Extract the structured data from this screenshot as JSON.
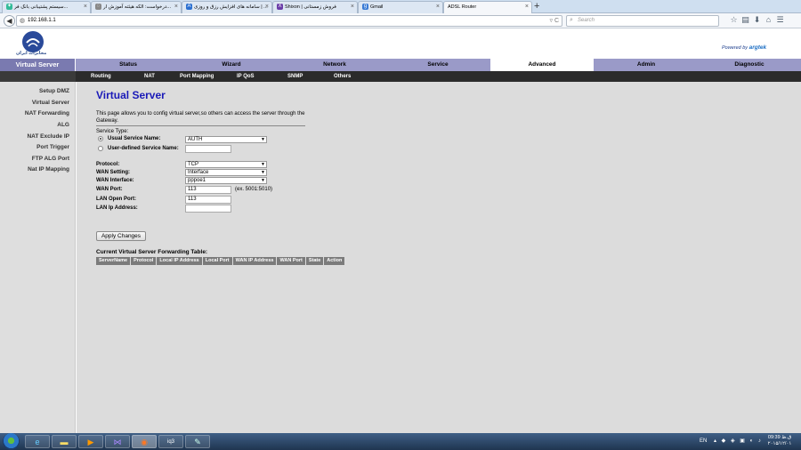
{
  "browser": {
    "tabs": [
      {
        "label": "سیستم پشتیبانی بانک فر...",
        "active": false
      },
      {
        "label": "درخواست: الکه هیئته آموزش ار...",
        "active": false
      },
      {
        "label": "سامانه های افزایش رزق و روزی | ...",
        "active": false
      },
      {
        "label": "Shixon | فروش زمستانی",
        "active": false
      },
      {
        "label": "Gmail",
        "active": false
      },
      {
        "label": "ADSL Router",
        "active": true
      }
    ],
    "url": "192.168.1.1",
    "search_placeholder": "Search"
  },
  "router": {
    "powered_prefix": "Powered by",
    "powered_brand": "argtek",
    "section_title": "Virtual Server",
    "menu": [
      "Status",
      "Wizard",
      "Network",
      "Service",
      "Advanced",
      "Admin",
      "Diagnostic"
    ],
    "menu_active": "Advanced",
    "submenu": [
      "Routing",
      "NAT",
      "Port Mapping",
      "IP QoS",
      "SNMP",
      "Others"
    ],
    "sidebar": [
      "Setup DMZ",
      "Virtual Server",
      "NAT Forwarding",
      "ALG",
      "NAT Exclude IP",
      "Port Trigger",
      "FTP ALG Port",
      "Nat IP Mapping"
    ]
  },
  "page": {
    "title": "Virtual Server",
    "description": "This page allows you to config virtual server,so others can access the server through the Gateway.",
    "service_type_label": "Service Type:",
    "usual_service_label": "Usual Service Name:",
    "usual_service_value": "AUTH",
    "user_defined_label": "User-defined Service Name:",
    "user_defined_value": "",
    "protocol_label": "Protocol:",
    "protocol_value": "TCP",
    "wan_setting_label": "WAN Setting:",
    "wan_setting_value": "Interface",
    "wan_interface_label": "WAN Interface:",
    "wan_interface_value": "pppoe1",
    "wan_port_label": "WAN Port:",
    "wan_port_value": "113",
    "wan_port_hint": "(ex. 5001:5010)",
    "lan_open_port_label": "LAN Open Port:",
    "lan_open_port_value": "113",
    "lan_ip_label": "LAN Ip Address:",
    "lan_ip_value": "",
    "apply_button": "Apply Changes",
    "table_title": "Current Virtual Server Forwarding Table:",
    "table_headers": [
      "ServerName",
      "Protocol",
      "Local IP Address",
      "Local Port",
      "WAN IP Address",
      "WAN Port",
      "State",
      "Action"
    ]
  },
  "taskbar": {
    "lang": "EN",
    "time": "09:39 ق.ظ",
    "date": "۲۰۱۵/۱۲/۰۱"
  }
}
